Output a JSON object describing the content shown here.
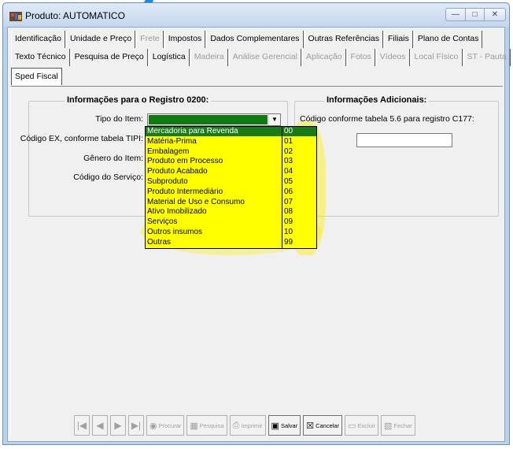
{
  "window": {
    "title": "Produto: AUTOMATICO"
  },
  "tabs": {
    "row1": [
      {
        "label": "Identificação",
        "disabled": false
      },
      {
        "label": "Unidade e Preço",
        "disabled": false
      },
      {
        "label": "Frete",
        "disabled": true
      },
      {
        "label": "Impostos",
        "disabled": false
      },
      {
        "label": "Dados Complementares",
        "disabled": false
      },
      {
        "label": "Outras Referências",
        "disabled": false
      },
      {
        "label": "Filiais",
        "disabled": false
      },
      {
        "label": "Plano de Contas",
        "disabled": false
      }
    ],
    "row2": [
      {
        "label": "Texto Técnico",
        "disabled": false
      },
      {
        "label": "Pesquisa de Preço",
        "disabled": false
      },
      {
        "label": "Logística",
        "disabled": false
      },
      {
        "label": "Madeira",
        "disabled": true
      },
      {
        "label": "Análise Gerencial",
        "disabled": true
      },
      {
        "label": "Aplicação",
        "disabled": true
      },
      {
        "label": "Fotos",
        "disabled": true
      },
      {
        "label": "Vídeos",
        "disabled": true
      },
      {
        "label": "Local Físico",
        "disabled": true
      },
      {
        "label": "ST - Pauta",
        "disabled": true
      }
    ],
    "row3": [
      {
        "label": "Sped Fiscal",
        "active": true
      }
    ]
  },
  "registro0200": {
    "title": "Informações para o Registro 0200:",
    "tipo_item_label": "Tipo do Item:",
    "codigo_ex_label": "Código EX, conforme tabela TIPI:",
    "genero_label": "Gênero do Item:",
    "codigo_servico_label": "Código do Serviço:"
  },
  "adicionais": {
    "title": "Informações Adicionais:",
    "codigo_177_label": "Código conforme tabela 5.6 para registro C177:"
  },
  "tipo_item_options": [
    {
      "name": "Mercadoria para Revenda",
      "code": "00"
    },
    {
      "name": "Matéria-Prima",
      "code": "01"
    },
    {
      "name": "Embalagem",
      "code": "02"
    },
    {
      "name": "Produto em Processo",
      "code": "03"
    },
    {
      "name": "Produto Acabado",
      "code": "04"
    },
    {
      "name": "Subproduto",
      "code": "05"
    },
    {
      "name": "Produto Intermediário",
      "code": "06"
    },
    {
      "name": "Material de Uso e Consumo",
      "code": "07"
    },
    {
      "name": "Ativo Imobilizado",
      "code": "08"
    },
    {
      "name": "Serviços",
      "code": "09"
    },
    {
      "name": "Outros insumos",
      "code": "10"
    },
    {
      "name": "Outras",
      "code": "99"
    }
  ],
  "toolbar": {
    "procurar": "Procurar",
    "pesquisa": "Pesquisa",
    "imprimir": "Imprimir",
    "salvar": "Salvar",
    "cancelar": "Cancelar",
    "excluir": "Excluir",
    "fechar": "Fechar"
  },
  "colors": {
    "highlight": "#ffff00",
    "selection": "#1a7a1a",
    "title_bar": "#c4d7ee"
  }
}
